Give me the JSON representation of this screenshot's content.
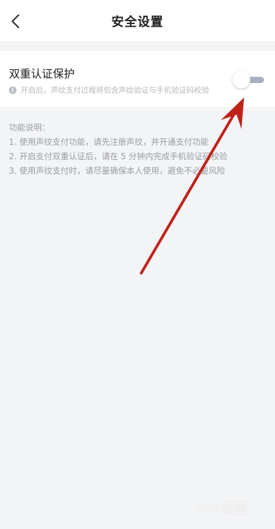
{
  "header": {
    "title": "安全设置",
    "back_icon": "chevron-left-icon"
  },
  "security_card": {
    "title": "双重认证保护",
    "description": "开启后，声纹支付过程将包含声纹验证与手机验证码校验",
    "info_icon": "info-icon",
    "info_glyph": "i",
    "toggle_state": "off"
  },
  "notes": {
    "heading": "功能说明：",
    "items": [
      "1. 使用声纹支付功能，请先注册声纹，并开通支付功能",
      "2. 开启支付双重认证后，请在 5 分钟内完成手机验证码校验",
      "3. 使用声纹支付时，请尽量确保本人使用，避免不必要风险"
    ]
  },
  "watermark": {
    "text": "Bai 经验"
  },
  "colors": {
    "arrow": "#c0221a",
    "toggle_track": "#a9aec0",
    "background": "#f3f4f6"
  }
}
